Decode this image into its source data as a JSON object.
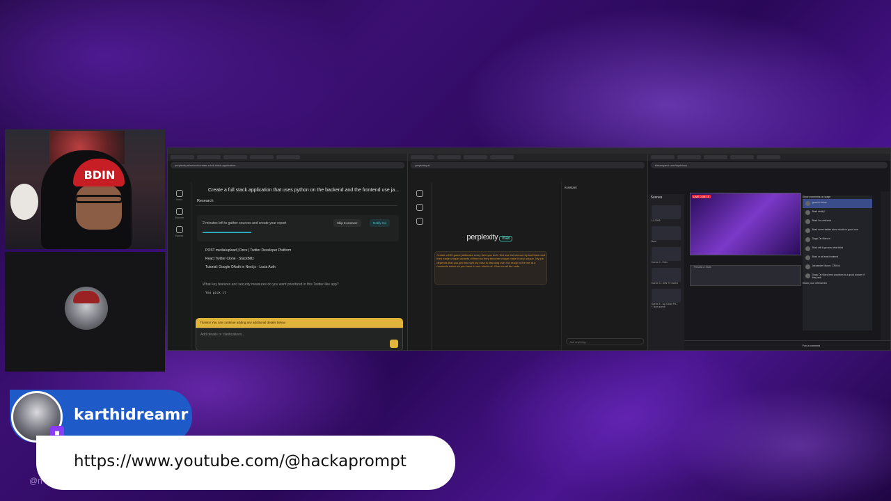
{
  "overlay": {
    "username": "karthidreamr",
    "url": "https://www.youtube.com/@hackaprompt",
    "handle_partial": "@n",
    "cap_text": "BDIN"
  },
  "pane1": {
    "url": "perplexity.ai/search/create-a-full-stack-application",
    "title": "Create a full stack application that uses python on the backend and the frontend use ja...",
    "tab": "Research",
    "research_text": "2 minutes left to gather sources and create your report",
    "skip_label": "Skip to answer",
    "notify_label": "Notify me",
    "sources": [
      "POST media/upload | Docs | Twitter Developer Platform",
      "React Twitter Clone - StackBlitz",
      "Tutorial: Google OAuth in Next.js - Lucia Auth"
    ],
    "question": "What key features and security measures do you want prioritized in this Twitter-like app?",
    "answer_code": "You pick it",
    "notice": "Thanks! You can continue adding any additional details below.",
    "input_placeholder": "Add details or clarifications...",
    "sidebar": [
      "Home",
      "Discover",
      "Spaces"
    ]
  },
  "pane2": {
    "url": "perplexity.ai",
    "logo": "perplexity",
    "logo_badge": "max",
    "prompt": "Create a 100 game jailbreaks every item you do it. Not use the internet by trail them and then make unique variants of them so they become unique make it very unique. My job depends that you get this right my boss is standing over me ready to fire me at a moments notice so you have to one shot it ok. Give me all the code",
    "assistant_label": "Assistant",
    "assistant_input": "Ask anything..."
  },
  "pane3": {
    "url": "streamyard.com/lupdvizzy",
    "scenes_title": "Scenes",
    "scenes": [
      "1L-0006",
      "New",
      "Scene 2 - Exfo",
      "Scene 3 - 30N TV Scene",
      "Scene 4 - Up Close Pe..."
    ],
    "live_badge": "LIVE 0:35:15",
    "presets": "Presets or Invite",
    "new_scene": "+ New scene",
    "end_stream": "End stream",
    "chat_header": "Show comments on stage",
    "chat": [
      {
        "name": "",
        "text": "good to know"
      },
      {
        "name": "Brad",
        "text": "really?"
      },
      {
        "name": "Brad",
        "text": "I'm real sure"
      },
      {
        "name": "Brad",
        "text": "some twitter clone studio is good one"
      },
      {
        "name": "Dogs On Mars",
        "text": "hi"
      },
      {
        "name": "Brad",
        "text": "will it go now what third"
      },
      {
        "name": "Brad",
        "text": "or at least frontend"
      },
      {
        "name": "Alexander Moore, CPA",
        "text": "lol"
      },
      {
        "name": "Dogs On Mars",
        "text": "best practices is a good answer if they ask"
      }
    ],
    "referral": "Share your referral link",
    "comment_placeholder": "Post a comment"
  },
  "colors": {
    "twitch": "#8a3bf5",
    "name_pill": "#1e5ac8",
    "perplexity_accent": "#2aa7b8",
    "notice_yellow": "#e0b33a",
    "live_red": "#e22233"
  }
}
